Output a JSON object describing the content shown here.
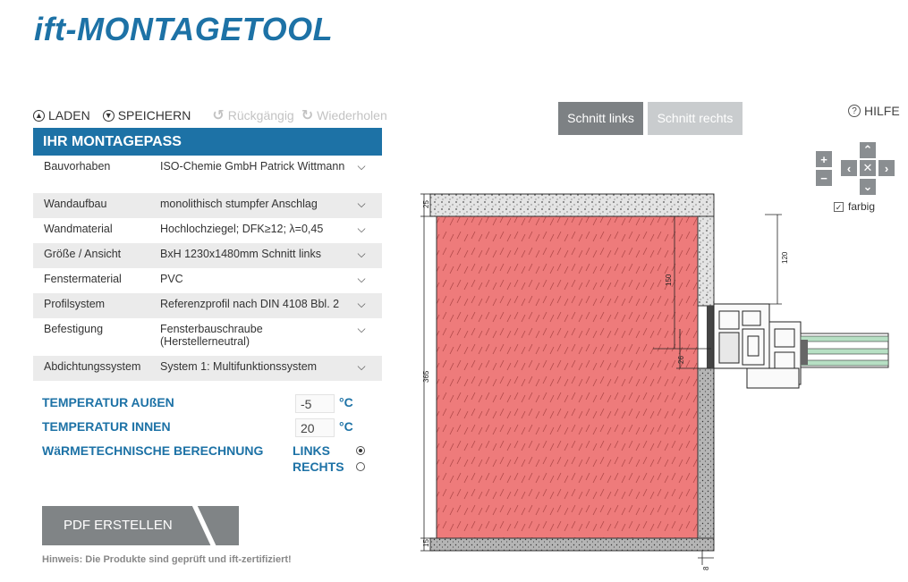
{
  "app": {
    "title": "ift-MONTAGETOOL"
  },
  "toolbar": {
    "load_label": "LADEN",
    "save_label": "SPEICHERN",
    "undo_label": "Rückgängig",
    "redo_label": "Wiederholen"
  },
  "panel": {
    "title": "IHR MONTAGEPASS",
    "rows": [
      {
        "label": "Bauvorhaben",
        "value": "ISO-Chemie GmbH Patrick Wittmann",
        "shaded": false
      },
      {
        "label": "Wandaufbau",
        "value": "monolithisch stumpfer Anschlag",
        "shaded": true
      },
      {
        "label": "Wandmaterial",
        "value": "Hochlochziegel; DFK≥12; λ=0,45",
        "shaded": false
      },
      {
        "label": "Größe / Ansicht",
        "value": "BxH 1230x1480mm Schnitt links",
        "shaded": true
      },
      {
        "label": "Fenstermaterial",
        "value": "PVC",
        "shaded": false
      },
      {
        "label": "Profilsystem",
        "value": "Referenzprofil nach DIN 4108 Bbl. 2",
        "shaded": true
      },
      {
        "label": "Befestigung",
        "value": "Fensterbauschraube (Herstellerneutral)",
        "shaded": false
      },
      {
        "label": "Abdichtungssystem",
        "value": "System 1: Multifunktionssystem",
        "shaded": true
      }
    ]
  },
  "temperatures": {
    "outside_label": "TEMPERATUR AUßEN",
    "outside_value": "-5",
    "inside_label": "TEMPERATUR INNEN",
    "inside_value": "20",
    "unit": "°C"
  },
  "calculation": {
    "label": "WäRMETECHNISCHE BERECHNUNG",
    "option_left": "LINKS",
    "option_right": "RECHTS",
    "selected": "LINKS"
  },
  "pdf_button": {
    "label": "PDF ERSTELLEN"
  },
  "hint": "Hinweis: Die Produkte sind geprüft und ift-zertifiziert!",
  "view": {
    "cut_left": "Schnitt links",
    "cut_right": "Schnitt rechts",
    "active_cut": "Schnitt links",
    "help_label": "HILFE",
    "colored_label": "farbig",
    "colored_checked": true
  },
  "dimensions": {
    "top_plaster": "25",
    "bottom_plaster": "15",
    "wall_thickness": "365",
    "offset_150": "150",
    "offset_120": "120",
    "offset_26": "26",
    "offset_8": "8"
  },
  "colors": {
    "brand_blue": "#1d72a6",
    "wall_red": "#ee7b7b",
    "button_gray": "#808486",
    "panel_shade": "#ebebeb"
  },
  "icons": {
    "load": "upload-circle-icon",
    "save": "download-circle-icon",
    "undo": "undo-icon",
    "redo": "redo-icon",
    "help": "question-circle-icon",
    "chevron": "chevron-down-icon"
  }
}
